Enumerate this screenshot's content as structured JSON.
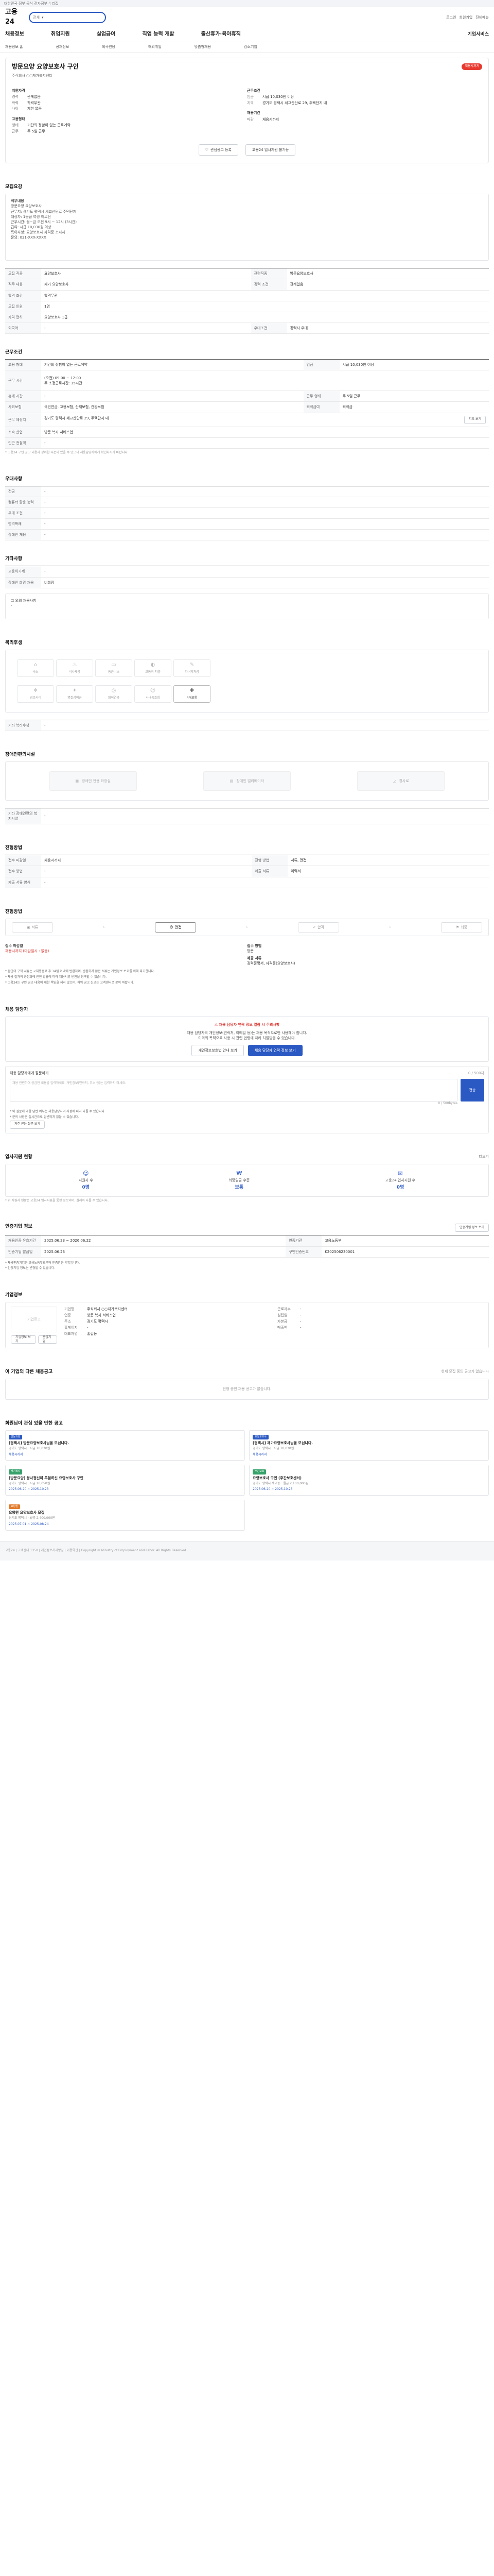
{
  "topstrip": {
    "text": "대한민국 정부 공식 전자정부 누리집"
  },
  "header": {
    "logo": "고용24",
    "search_scope": "전체",
    "search_placeholder": "검색어를 입력하세요",
    "right_links": [
      "로그인",
      "회원가입",
      "전체메뉴"
    ]
  },
  "nav": {
    "items": [
      "채용정보",
      "취업지원",
      "실업급여",
      "직업 능력 개발",
      "출산휴가·육아휴직"
    ],
    "extra": "기업서비스"
  },
  "subnav": {
    "items": [
      "채용정보 홈",
      "공채정보",
      "외국인용",
      "해외취업",
      "맞춤형채용",
      "강소기업"
    ]
  },
  "title_card": {
    "title": "방문요양 요양보호사 구인",
    "badge": "채용시까지",
    "company": "주식회사 ○○재가복지센터",
    "left_heading": "지원자격",
    "left_rows": [
      {
        "k": "경력",
        "v": "관계없음"
      },
      {
        "k": "학력",
        "v": "학력무관"
      },
      {
        "k": "나이",
        "v": "제한 없음"
      }
    ],
    "left_heading2": "고용형태",
    "left_rows2": [
      {
        "k": "형태",
        "v": "기간의 정함이 없는 근로계약"
      },
      {
        "k": "근무",
        "v": "주 5일 근무"
      }
    ],
    "right_heading": "근무조건",
    "right_rows": [
      {
        "k": "임금",
        "v": "시급 10,030원 이상"
      },
      {
        "k": "지역",
        "v": "경기도 평택시 세교산단로 29, 주택단지 내"
      }
    ],
    "right_heading2": "채용기간",
    "right_rows2": [
      {
        "k": "마감",
        "v": "채용시까지"
      }
    ],
    "btn_apply": "관심공고 등록",
    "btn_share": "고용24 입사지원 불가능"
  },
  "job_intro": {
    "title": "모집요강",
    "lines": [
      "직무내용",
      "방문요양 요양보호사",
      "근무지: 경기도 평택시 세교산단로 주택단지",
      "대상자: 1등급 여성 어르신",
      "근무시간: 월~금 오전 9시 ~ 12시 (3시간)",
      "급여: 시급 10,030원 이상",
      "특이사항: 요양보호사 자격증 소지자",
      "문의: 031-XXX-XXXX"
    ]
  },
  "recruit_table": {
    "rows": [
      [
        {
          "k": "모집 직종",
          "v": "요양보호사"
        },
        {
          "k": "관련직종",
          "v": "방문요양보호사"
        }
      ],
      [
        {
          "k": "직무 내용",
          "v": "재가 요양보호사"
        },
        {
          "k": "경력 조건",
          "v": "관계없음"
        }
      ],
      [
        {
          "k": "학력 조건",
          "v": "학력무관"
        },
        {
          "k": "",
          "v": ""
        }
      ],
      [
        {
          "k": "모집 인원",
          "v": "1명"
        },
        {
          "k": "",
          "v": ""
        }
      ],
      [
        {
          "k": "자격 면허",
          "v": "요양보호사 1급"
        },
        {
          "k": "",
          "v": ""
        }
      ],
      [
        {
          "k": "외국어",
          "v": "-"
        },
        {
          "k": "우대조건",
          "v": "경력자 우대"
        }
      ]
    ]
  },
  "conditions": {
    "title": "근무조건",
    "rows": [
      [
        {
          "k": "고용 형태",
          "v": "기간의 정함이 없는 근로계약"
        },
        {
          "k": "임금",
          "v": "시급 10,030원 이상"
        }
      ],
      [
        {
          "k": "근무 시간",
          "v": "(오전) 09:00 ~ 12:00\n주 소정근로시간: 15시간"
        },
        {
          "k": "",
          "v": ""
        }
      ],
      [
        {
          "k": "휴게 시간",
          "v": "-"
        },
        {
          "k": "근무 형태",
          "v": "주 5일 근무"
        }
      ],
      [
        {
          "k": "사회보험",
          "v": "국민연금, 고용보험, 산재보험, 건강보험"
        },
        {
          "k": "퇴직급여",
          "v": "퇴직금"
        }
      ],
      [
        {
          "k": "근무 예정지",
          "v": "경기도 평택시 세교산단로 29, 주택단지 내"
        },
        {
          "k": "",
          "v": ""
        }
      ],
      [
        {
          "k": "소속 산업",
          "v": "방문 복지 서비스업"
        },
        {
          "k": "",
          "v": ""
        }
      ],
      [
        {
          "k": "인근 전철역",
          "v": "-"
        },
        {
          "k": "",
          "v": ""
        }
      ]
    ],
    "map_btn": "지도 보기",
    "note": "* 고용24 구인 공고 내용과 상이한 부분이 있을 수 있으니 채용담당자에게 확인하시기 바랍니다."
  },
  "preference": {
    "title": "우대사항",
    "rows": [
      {
        "k": "전공",
        "v": "-"
      },
      {
        "k": "컴퓨터 활용 능력",
        "v": "-"
      },
      {
        "k": "우대 조건",
        "v": "-"
      },
      {
        "k": "병역특례",
        "v": "-"
      },
      {
        "k": "장애인 채용",
        "v": "-"
      }
    ]
  },
  "etc": {
    "title": "기타사항",
    "rows": [
      {
        "k": "고용허가제",
        "v": "-"
      },
      {
        "k": "장애인 희망 채용",
        "v": "비희망"
      }
    ],
    "company_info_label": "그 외의 채용사항",
    "company_info_value": "-"
  },
  "welfare": {
    "title": "복리후생",
    "icons": [
      {
        "name": "숙소",
        "on": false
      },
      {
        "name": "식사제공",
        "on": false
      },
      {
        "name": "통근버스",
        "on": false
      },
      {
        "name": "교통비 지급",
        "on": false
      },
      {
        "name": "자녀학자금",
        "on": false
      },
      {
        "name": "경조사비",
        "on": false
      },
      {
        "name": "명절상여금",
        "on": false
      },
      {
        "name": "퇴직연금",
        "on": false
      },
      {
        "name": "사내동호회",
        "on": false
      },
      {
        "name": "4대보험",
        "on": true
      }
    ],
    "extra_label": "기타 복리후생",
    "extra_value": "-"
  },
  "facility": {
    "title": "장애인편의시설",
    "items": [
      "장애인 전용 화장실",
      "장애인 엘리베이터",
      "경사로"
    ],
    "note_label": "기타 장애인편의 복지시설",
    "note_value": "-"
  },
  "selection": {
    "title": "전형방법",
    "rows": [
      [
        {
          "k": "접수 마감일",
          "v": "채용시까지"
        },
        {
          "k": "전형 방법",
          "v": "서류, 면접"
        }
      ],
      [
        {
          "k": "접수 방법",
          "v": "-"
        },
        {
          "k": "제출 서류",
          "v": "이력서"
        }
      ],
      [
        {
          "k": "제출 서류 양식",
          "v": "-"
        },
        {
          "k": "",
          "v": ""
        }
      ]
    ]
  },
  "process": {
    "title": "전형방법",
    "steps": [
      "서류",
      "면접",
      "합격",
      "최종"
    ],
    "left_line1": "접수 마감일",
    "left_line2": "채용시까지 (마감일시 : 없음)",
    "right_line1": "접수 방법",
    "right_line2": "방문",
    "right_line3": "제출 서류",
    "right_line4": "경력증명서, 자격증(요양보호사)",
    "notes": [
      "* 본인의 구직 서류는 <채용종료 후 14일 이내에 반환하며, 반환하지 않은 서류는 개인정보 보호를 위해 파기합니다.",
      "* 채용 절차의 공정화에 관한 법률에 따라 채용서류 반환을 청구할 수 있습니다.",
      "* 고용24는 구인 공고 내용에 대한 책임을 지지 않으며, 허위 공고 신고는 고객센터로 문의 바랍니다."
    ]
  },
  "contact": {
    "title": "채용 담당자",
    "warn": "채용 담당자 연락 정보 열람 시 주의사항",
    "desc1": "채용 담당자의 개인정보(연락처, 이메일 등)는 채용 목적으로만 사용해야 합니다.",
    "desc2": "이외의 목적으로 사용 시 관련 법령에 따라 처벌받을 수 있습니다.",
    "btn1": "개인정보보호법 안내 보기",
    "btn2": "채용 담당자 연락 정보 보기"
  },
  "question": {
    "head_left": "채용 담당자에게 질문하기",
    "head_right": "0 / 500자",
    "placeholder": "채용 관련하여 궁금한 내용을 입력하세요. 개인정보(연락처, 주소 등)는 입력하지 마세요.",
    "count": "0 / 500bytes",
    "send": "전송",
    "notes": [
      "* 이 질문에 대한 답변 여부는 채용담당자의 사정에 따라 다를 수 있습니다.",
      "* 문의 사항은 실시간으로 답변되지 않을 수 있습니다."
    ],
    "faq_btn": "자주 묻는 질문 보기"
  },
  "score": {
    "title": "입사지원 현황",
    "right": "더보기",
    "items": [
      {
        "label": "지원자 수",
        "level": "0명"
      },
      {
        "label": "희망임금 수준",
        "level": "보통"
      },
      {
        "label": "고용24 입사지원 수",
        "level": "0명"
      }
    ],
    "note": "* 위 지원자 현황은 고용24 입사지원을 통한 정보이며, 실제와 다를 수 있습니다."
  },
  "company": {
    "title": "인증기업 정보",
    "btn": "인증기업 정보 보기",
    "rows": [
      [
        {
          "k": "채용인증 유효기간",
          "v": "2025.06.23 ~ 2026.06.22"
        },
        {
          "k": "인증기관",
          "v": "고용노동부"
        }
      ],
      [
        {
          "k": "인증기업 발급일",
          "v": "2025.06.23"
        },
        {
          "k": "구인인증번호",
          "v": "K202506230001"
        }
      ]
    ],
    "notes": [
      "* 채용인증기업은 고용노동부로부터 인증받은 기업입니다.",
      "* 인증기업 정보는 변경될 수 있습니다."
    ]
  },
  "corp_info": {
    "title": "기업정보",
    "logo_text": "기업로고",
    "rows": [
      {
        "k": "기업명",
        "v": "주식회사 ○○재가복지센터"
      },
      {
        "k": "업종",
        "v": "방문 복지 서비스업"
      },
      {
        "k": "주소",
        "v": "경기도 평택시"
      },
      {
        "k": "홈페이지",
        "v": "-"
      },
      {
        "k": "대표자명",
        "v": "홍길동"
      }
    ],
    "rows2": [
      {
        "k": "근로자수",
        "v": "-"
      },
      {
        "k": "설립일",
        "v": "-"
      },
      {
        "k": "자본금",
        "v": "-"
      },
      {
        "k": "매출액",
        "v": "-"
      }
    ],
    "btn1": "기업정보 보기",
    "btn2": "관심기업"
  },
  "other_jobs": {
    "title": "이 기업의 다른 채용공고",
    "right": "현재 모집 중인 공고가 없습니다",
    "empty": "진행 중인 채용 공고가 없습니다."
  },
  "recommend": {
    "title": "회원님이 관심 있을 만한 공고",
    "cards": [
      {
        "tag": "방문요양",
        "title": "[평택시] 방문요양보호사님을 모십니다.",
        "sub": "경기도 평택시 · 시급 10,030원",
        "meta": "채용시까지"
      },
      {
        "tag": "요양보호사",
        "title": "[평택시] 재가요양보호사님을 모십니다.",
        "sub": "경기도 평택시 · 시급 10,030원",
        "meta": "채용시까지"
      },
      {
        "tag": "재가복지",
        "title": "[방문요양] 봉사정신이 투철하신 요양보호사 구인",
        "sub": "경기도 평택시 · 시급 10,050원",
        "meta": "2025.06.20 ~ 2025.10.23"
      },
      {
        "tag": "주간보호",
        "title": "요양보호사 구인 (주간보호센터)",
        "sub": "경기도 평택시 세교동 · 월급 2,100,000원",
        "meta": "2025.06.20 ~ 2025.10.23"
      },
      {
        "tag": "요양원",
        "title": "요양원 요양보호사 모집",
        "sub": "경기도 평택시 · 월급 2,400,000원",
        "meta": "2025.07.01 ~ 2025.08.24"
      }
    ]
  },
  "footer": {
    "text": "고용24 | 고객센터 1350 | 개인정보처리방침 | 이용약관 | Copyright © Ministry of Employment and Labor. All Rights Reserved."
  }
}
